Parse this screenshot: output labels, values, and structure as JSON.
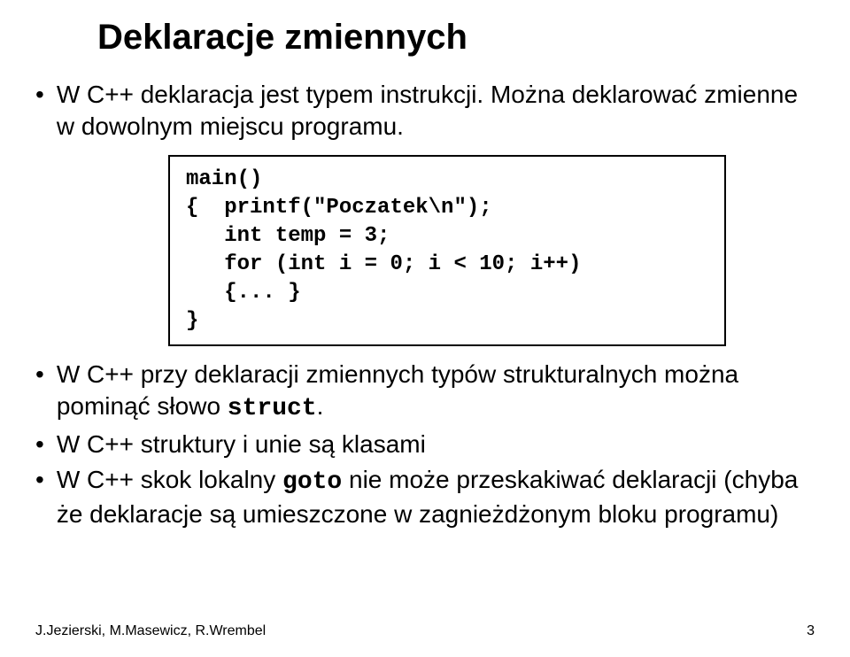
{
  "title": "Deklaracje zmiennych",
  "bullets": {
    "b1": "W C++ deklaracja jest typem instrukcji. Można deklarować zmienne w dowolnym miejscu programu.",
    "b2_pre": "W C++ przy deklaracji zmiennych typów strukturalnych można pominąć słowo ",
    "b2_code": "struct",
    "b2_post": ".",
    "b3": "W C++ struktury i unie są klasami",
    "b4_pre": "W C++ skok lokalny ",
    "b4_code": "goto",
    "b4_post": " nie może przeskakiwać deklaracji (chyba że deklaracje są umieszczone w zagnieżdżonym bloku programu)"
  },
  "code": "main()\n{  printf(\"Poczatek\\n\");\n   int temp = 3;\n   for (int i = 0; i < 10; i++)\n   {... }\n}",
  "footer": "J.Jezierski, M.Masewicz, R.Wrembel",
  "page_number": "3"
}
